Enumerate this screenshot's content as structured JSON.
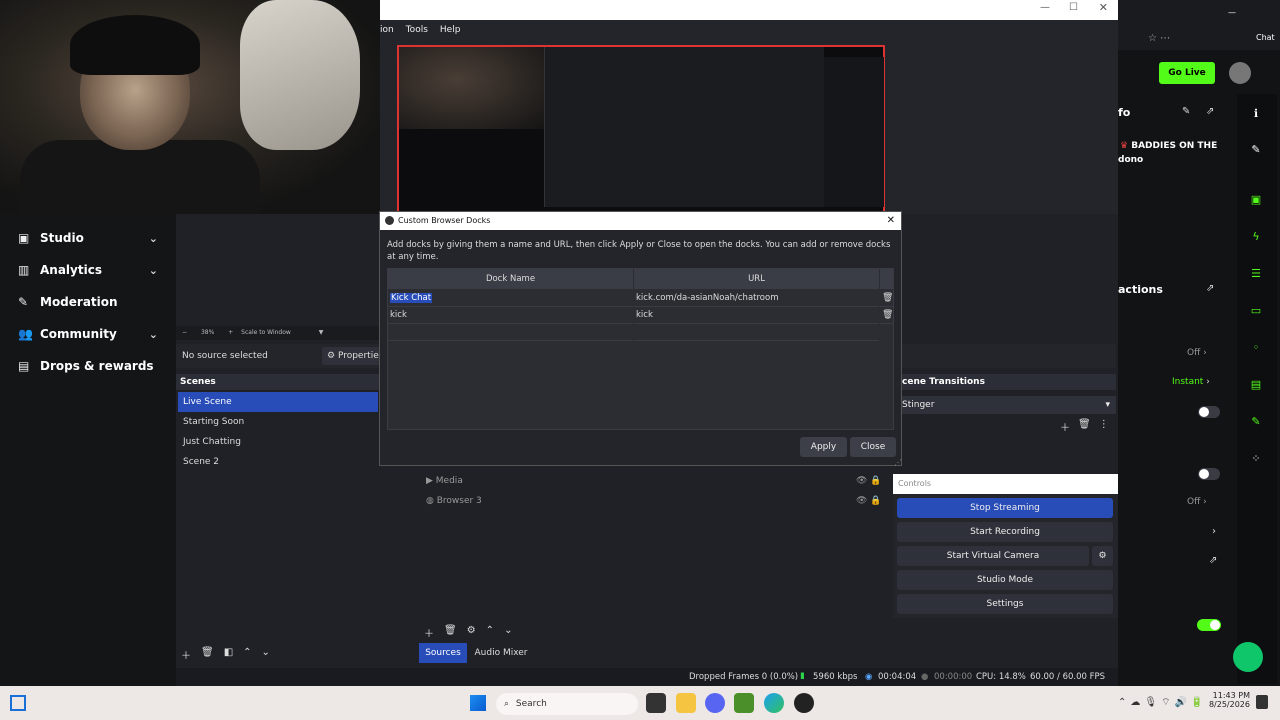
{
  "kick_sidebar": {
    "items": [
      {
        "label": "Studio",
        "icon": "studio-icon",
        "chevron": true
      },
      {
        "label": "Analytics",
        "icon": "analytics-icon",
        "chevron": true
      },
      {
        "label": "Moderation",
        "icon": "wrench-icon",
        "chevron": false
      },
      {
        "label": "Community",
        "icon": "community-icon",
        "chevron": true
      },
      {
        "label": "Drops & rewards",
        "icon": "gift-icon",
        "chevron": false
      }
    ]
  },
  "obs": {
    "menu": [
      "ion",
      "Tools",
      "Help"
    ],
    "zoom": "38%",
    "scale": "Scale to Window",
    "no_source": "No source selected",
    "properties": "Properties",
    "scenes_header": "Scenes",
    "scenes": [
      "Live Scene",
      "Starting Soon",
      "Just Chatting",
      "Scene 2"
    ],
    "sources": [
      "Media",
      "Browser 3"
    ],
    "tabs": {
      "sources": "Sources",
      "audio": "Audio Mixer"
    },
    "transitions_header": "cene Transitions",
    "transition": "Stinger",
    "controls_header": "Controls",
    "controls": [
      "Stop Streaming",
      "Start Recording",
      "Start Virtual Camera",
      "Studio Mode",
      "Settings"
    ],
    "status": {
      "dropped": "Dropped Frames 0 (0.0%)",
      "kbps": "5960 kbps",
      "time": "00:04:04",
      "rec_time": "00:00:00",
      "cpu": "CPU: 14.8%",
      "fps": "60.00 / 60.00 FPS"
    }
  },
  "dialog": {
    "title": "Custom Browser Docks",
    "description": "Add docks by giving them a name and URL, then click Apply or Close to open the docks. You can add or remove docks at any time.",
    "col_name": "Dock Name",
    "col_url": "URL",
    "rows": [
      {
        "name": "Kick Chat",
        "url": "kick.com/da-asianNoah/chatroom"
      },
      {
        "name": "kick",
        "url": "kick"
      }
    ],
    "apply": "Apply",
    "close": "Close"
  },
  "right": {
    "chat": "Chat",
    "go_live": "Go Live",
    "info": "fo",
    "stream_title": "BADDIES ON THE",
    "stream_sub": "dono",
    "actions": "actions",
    "off1": "Off",
    "instant": "Instant",
    "off2": "Off"
  },
  "taskbar": {
    "search": "Search",
    "time": "11:43 PM",
    "date": "8/25/2026"
  },
  "colors": {
    "accent": "#284cb8",
    "kick_green": "#53fc18",
    "live_red": "#d33"
  }
}
